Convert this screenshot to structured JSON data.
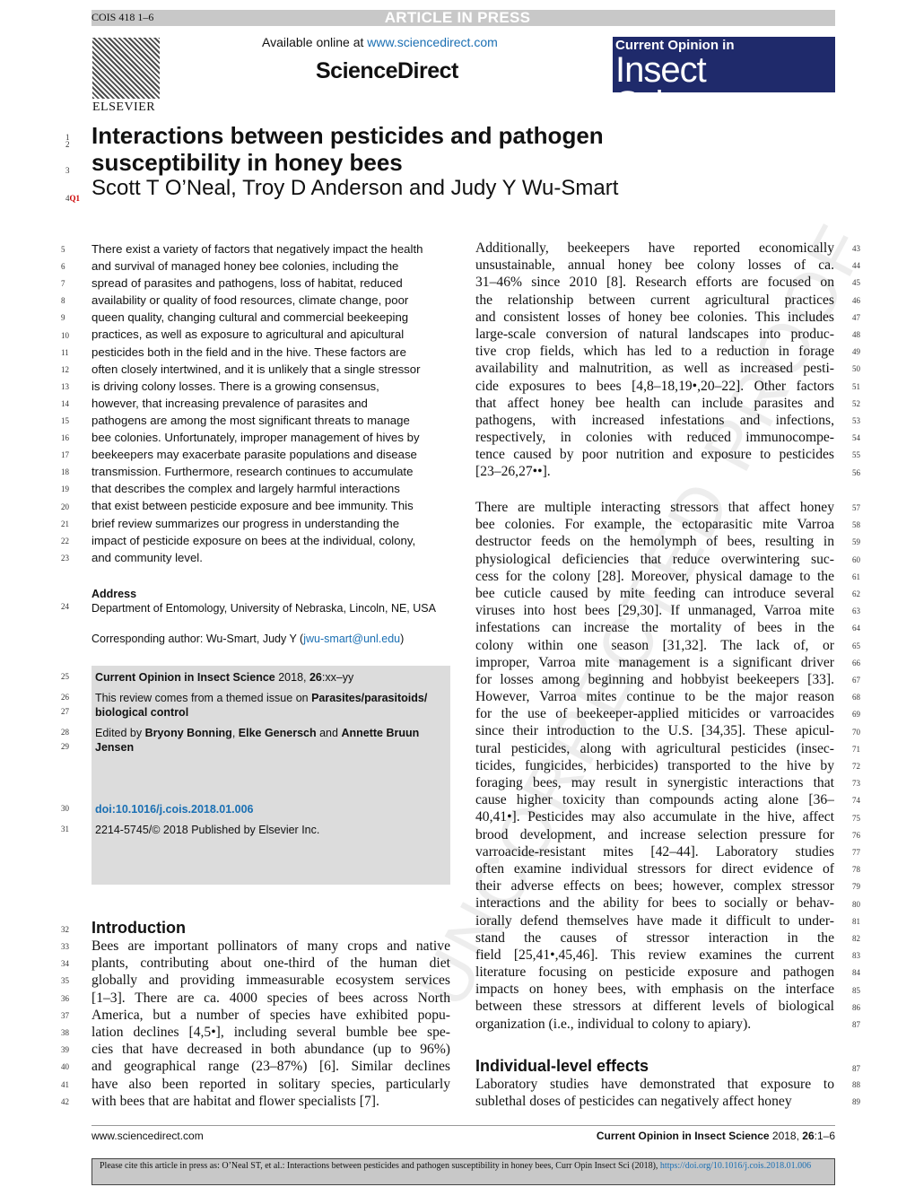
{
  "header": {
    "code": "COIS 418 1–6",
    "banner": "ARTICLE IN PRESS",
    "publisher": "ELSEVIER",
    "available": "Available online at ",
    "available_link": "www.sciencedirect.com",
    "platform": "ScienceDirect",
    "journal_line1": "Current Opinion in",
    "journal_line2": "Insect Science"
  },
  "watermark": "UNCORRECTED PROOF",
  "title_lines": [
    "Interactions between pesticides and pathogen",
    "susceptibility in honey bees"
  ],
  "authors": "Scott T O’Neal, Troy D Anderson and Judy Y Wu-Smart",
  "query_mark": "Q1",
  "title_line_numbers": [
    "1",
    "2",
    "3",
    "4"
  ],
  "abstract": {
    "start": 5,
    "lines": [
      "There exist a variety of factors that negatively impact the health",
      "and survival of managed honey bee colonies, including the",
      "spread of parasites and pathogens, loss of habitat, reduced",
      "availability or quality of food resources, climate change, poor",
      "queen quality, changing cultural and commercial beekeeping",
      "practices, as well as exposure to agricultural and apicultural",
      "pesticides both in the field and in the hive. These factors are",
      "often closely intertwined, and it is unlikely that a single stressor",
      "is driving colony losses. There is a growing consensus,",
      "however, that increasing prevalence of parasites and",
      "pathogens are among the most significant threats to manage",
      "bee colonies. Unfortunately, improper management of hives by",
      "beekeepers may exacerbate parasite populations and disease",
      "transmission. Furthermore, research continues to accumulate",
      "that describes the complex and largely harmful interactions",
      "that exist between pesticide exposure and bee immunity. This",
      "brief review summarizes our progress in understanding the",
      "impact of pesticide exposure on bees at the individual, colony,",
      "and community level."
    ]
  },
  "address": {
    "heading": "Address",
    "line_no": "24",
    "text": "Department of Entomology, University of Nebraska, Lincoln, NE, USA",
    "corresponding": "Corresponding author: Wu-Smart, Judy Y (",
    "email": "jwu-smart@unl.edu",
    "corresponding_end": ")"
  },
  "box": {
    "journal": "Current Opinion in Insect Science",
    "year_vol": " 2018, ",
    "vol": "26",
    "pages": ":xx–yy",
    "themed_prefix": "This review comes from a themed issue on ",
    "theme1": "Parasites/parasitoids/",
    "theme2": "biological control",
    "edited_prefix": "Edited by ",
    "editor1": "Bryony Bonning",
    "sep": ", ",
    "editor2": "Elke Genersch",
    "and": " and ",
    "editor3a": "Annette Bruun",
    "editor3b": "Jensen",
    "doi": "doi:10.1016/j.cois.2018.01.006",
    "issn": "2214-5745/© 2018 Published by Elsevier Inc.",
    "line_nos": [
      "25",
      "26",
      "27",
      "28",
      "29",
      "30",
      "31"
    ]
  },
  "introduction": {
    "heading": "Introduction",
    "heading_no": "32",
    "start": 33,
    "lines": [
      "Bees are important pollinators of many crops and native",
      "plants, contributing about one-third of the human diet",
      "globally and providing immeasurable ecosystem services",
      "[1–3]. There are ca. 4000 species of bees across North",
      "America, but a number of species have exhibited popu-",
      "lation declines [4,5•], including several bumble bee spe-",
      "cies that have decreased in both abundance (up to 96%)",
      "and geographical range (23–87%) [6]. Similar declines",
      "have also been reported in solitary species, particularly",
      "with bees that are habitat and flower specialists [7]."
    ]
  },
  "right_col": {
    "para1": {
      "start": 43,
      "lines": [
        "Additionally, beekeepers have reported economically",
        "unsustainable, annual honey bee colony losses of ca.",
        "31–46% since 2010 [8]. Research efforts are focused on",
        "the relationship between current agricultural practices",
        "and consistent losses of honey bee colonies. This includes",
        "large-scale conversion of natural landscapes into produc-",
        "tive crop fields, which has led to a reduction in forage",
        "availability and malnutrition, as well as increased pesti-",
        "cide exposures to bees [4,8–18,19•,20–22]. Other factors",
        "that affect honey bee health can include parasites and",
        "pathogens, with increased infestations and infections,",
        "respectively, in colonies with reduced immunocompe-",
        "tence caused by poor nutrition and exposure to pesticides",
        "[23–26,27••]."
      ]
    },
    "para2": {
      "start": 57,
      "lines": [
        "There are multiple interacting stressors that affect honey",
        "bee colonies. For example, the ectoparasitic mite Varroa",
        "destructor feeds on the hemolymph of bees, resulting in",
        "physiological deficiencies that reduce overwintering suc-",
        "cess for the colony [28]. Moreover, physical damage to the",
        "bee cuticle caused by mite feeding can introduce several",
        "viruses into host bees [29,30]. If unmanaged, Varroa mite",
        "infestations can increase the mortality of bees in the",
        "colony within one season [31,32]. The lack of, or",
        "improper, Varroa mite management is a significant driver",
        "for losses among beginning and hobbyist beekeepers [33].",
        "However, Varroa mites continue to be the major reason",
        "for the use of beekeeper-applied miticides or varroacides",
        "since their introduction to the U.S. [34,35]. These apicul-",
        "tural pesticides, along with agricultural pesticides (insec-",
        "ticides, fungicides, herbicides) transported to the hive by",
        "foraging bees, may result in synergistic interactions that",
        "cause higher toxicity than compounds acting alone [36–",
        "40,41•]. Pesticides may also accumulate in the hive, affect",
        "brood development, and increase selection pressure for",
        "varroacide-resistant mites [42–44]. Laboratory studies",
        "often examine individual stressors for direct evidence of",
        "their adverse effects on bees; however, complex stressor",
        "interactions and the ability for bees to socially or behav-",
        "iorally defend themselves have made it difficult to under-",
        "stand the causes of stressor interaction in the",
        "field [25,41•,45,46]. This review examines the current",
        "literature focusing on pesticide exposure and pathogen",
        "impacts on honey bees, with emphasis on the interface",
        "between these stressors at different levels of biological",
        "organization (i.e., individual to colony to apiary)."
      ]
    },
    "heading": "Individual-level effects",
    "heading_no": "87",
    "para3": {
      "start": 88,
      "lines": [
        "Laboratory studies have demonstrated that exposure to",
        "sublethal doses of pesticides can negatively affect honey"
      ]
    }
  },
  "footer": {
    "left": "www.sciencedirect.com",
    "journal": "Current Opinion in Insect Science",
    "rest": " 2018, ",
    "vol": "26",
    "pages": ":1–6"
  },
  "citation": {
    "text": "Please cite this article in press as: O’Neal ST, et al.: Interactions between pesticides and pathogen susceptibility in honey bees, Curr Opin Insect Sci (2018), ",
    "link": "https://doi.org/10.1016/j.cois.2018.01.006"
  },
  "colors": {
    "journal_bg": "#1f2a6b",
    "link": "#1a6fb3",
    "banner": "#c8c8c8",
    "box": "#dcdcdc"
  }
}
